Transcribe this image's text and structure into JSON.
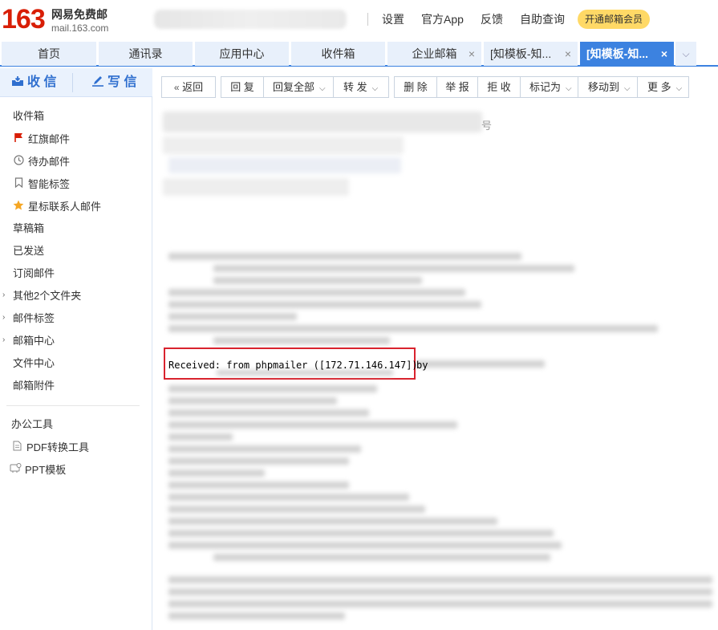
{
  "header": {
    "logo_number": "163",
    "logo_name": "网易免费邮",
    "logo_url": "mail.163.com",
    "links": [
      "设置",
      "官方App",
      "反馈",
      "自助查询"
    ],
    "vip_button": "开通邮箱会员"
  },
  "tabs": [
    {
      "label": "首页",
      "closable": false,
      "active": false
    },
    {
      "label": "通讯录",
      "closable": false,
      "active": false
    },
    {
      "label": "应用中心",
      "closable": false,
      "active": false
    },
    {
      "label": "收件箱",
      "closable": false,
      "active": false
    },
    {
      "label": "企业邮箱",
      "closable": true,
      "active": false
    },
    {
      "label": "[知模板-知...",
      "closable": true,
      "active": false
    },
    {
      "label": "[知模板-知...",
      "closable": true,
      "active": true
    }
  ],
  "tab_close_glyph": "×",
  "tab_more_glyph": "⌵",
  "sidebar": {
    "receive": "收 信",
    "compose": "写 信",
    "items": [
      {
        "label": "收件箱",
        "icon": ""
      },
      {
        "label": "红旗邮件",
        "icon": "red-flag-icon"
      },
      {
        "label": "待办邮件",
        "icon": "clock-icon"
      },
      {
        "label": "智能标签",
        "icon": "bookmark-icon"
      },
      {
        "label": "星标联系人邮件",
        "icon": "star-icon"
      },
      {
        "label": "草稿箱",
        "icon": ""
      },
      {
        "label": "已发送",
        "icon": ""
      },
      {
        "label": "订阅邮件",
        "icon": ""
      },
      {
        "label": "其他2个文件夹",
        "icon": "",
        "expandable": true
      },
      {
        "label": "邮件标签",
        "icon": "",
        "expandable": true
      },
      {
        "label": "邮箱中心",
        "icon": "",
        "expandable": true
      },
      {
        "label": "文件中心",
        "icon": ""
      },
      {
        "label": "邮箱附件",
        "icon": ""
      }
    ],
    "tools_title": "办公工具",
    "tools": [
      {
        "label": "PDF转换工具",
        "icon": "pdf-file-icon"
      },
      {
        "label": "PPT模板",
        "icon": "ppt-template-icon"
      }
    ]
  },
  "toolbar": {
    "back": "返回",
    "reply": "回 复",
    "reply_all": "回复全部",
    "forward": "转 发",
    "delete": "删 除",
    "report": "举 报",
    "reject": "拒 收",
    "mark_as": "标记为",
    "move_to": "移动到",
    "more": "更 多"
  },
  "content": {
    "partial_char": "号",
    "received_text": "Received: from phpmailer ([172.71.146.147])",
    "received_by": "by"
  },
  "colors": {
    "brand_red": "#d81e06",
    "accent_blue": "#3c82e0",
    "highlight_red": "#d9232e",
    "vip_yellow": "#ffd966"
  }
}
